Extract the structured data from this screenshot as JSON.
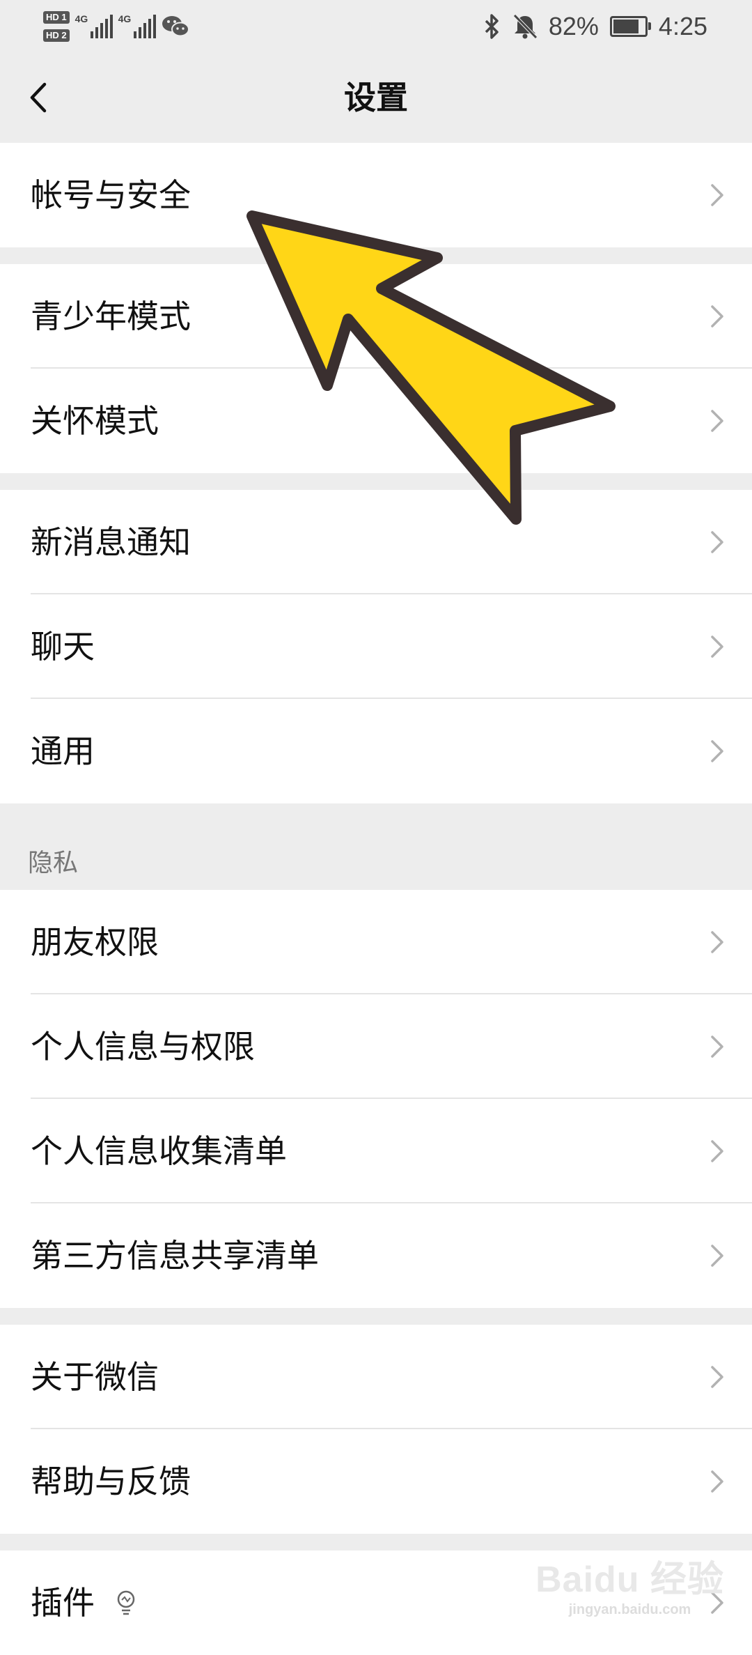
{
  "status_bar": {
    "hd1": "HD 1",
    "hd2": "HD 2",
    "net1": "4G",
    "net2": "4G",
    "wechat_icon": "wechat-icon",
    "bluetooth_icon": "bluetooth-icon",
    "mute_icon": "bell-off-icon",
    "battery_percent": "82%",
    "battery_level": 0.82,
    "time": "4:25"
  },
  "navbar": {
    "back_icon": "chevron-left-icon",
    "title": "设置"
  },
  "groups": [
    {
      "items": [
        {
          "label": "帐号与安全"
        }
      ]
    },
    {
      "items": [
        {
          "label": "青少年模式"
        },
        {
          "label": "关怀模式"
        }
      ]
    },
    {
      "items": [
        {
          "label": "新消息通知"
        },
        {
          "label": "聊天"
        },
        {
          "label": "通用"
        }
      ]
    },
    {
      "header": "隐私",
      "items": [
        {
          "label": "朋友权限"
        },
        {
          "label": "个人信息与权限"
        },
        {
          "label": "个人信息收集清单"
        },
        {
          "label": "第三方信息共享清单"
        }
      ]
    },
    {
      "items": [
        {
          "label": "关于微信"
        },
        {
          "label": "帮助与反馈"
        }
      ]
    },
    {
      "items": [
        {
          "label": "插件"
        }
      ]
    }
  ],
  "overlay": {
    "arrow_color": "#ffd617",
    "arrow_outline": "#3a2f2f"
  },
  "watermark": {
    "main": "Baidu 经验",
    "sub": "jingyan.baidu.com"
  },
  "colors": {
    "background": "#ededed",
    "cell": "#ffffff",
    "text": "#111111",
    "chevron": "#b2b2b2"
  }
}
